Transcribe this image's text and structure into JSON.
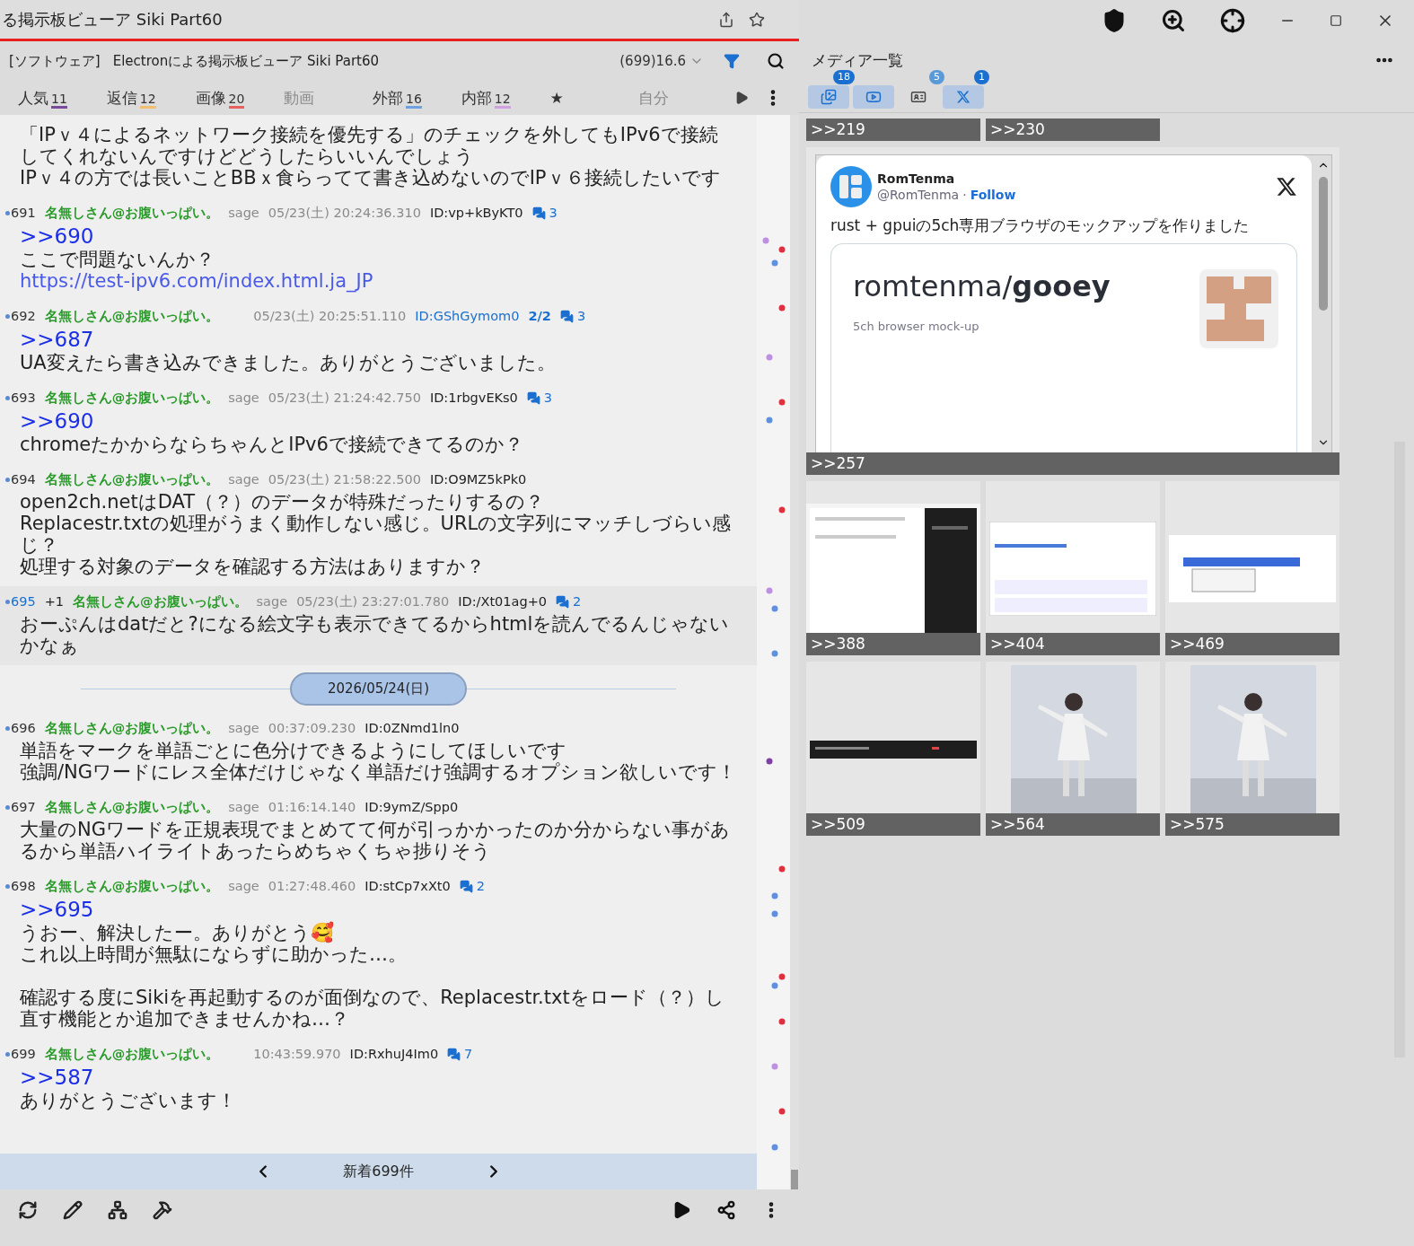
{
  "window": {
    "title": "る掲示板ビューア Siki Part60"
  },
  "thread": {
    "category": "[ソフトウェア]",
    "title": "Electronによる掲示板ビューア Siki Part60",
    "stats": "(699)16.6"
  },
  "tabs": [
    {
      "label": "人気",
      "count": "11",
      "color": "#7a4a9a",
      "disabled": false
    },
    {
      "label": "返信",
      "count": "12",
      "color": "#f0c070",
      "disabled": false
    },
    {
      "label": "画像",
      "count": "20",
      "color": "#e86060",
      "disabled": false
    },
    {
      "label": "動画",
      "disabled": true
    },
    {
      "label": "外部",
      "count": "16",
      "color": "#70a0e0",
      "disabled": false
    },
    {
      "label": "内部",
      "count": "12",
      "color": "#d0a0e0",
      "disabled": false
    },
    {
      "label": "★",
      "disabled": false
    },
    {
      "label": "自分",
      "disabled": true
    }
  ],
  "posts": [
    {
      "kind": "post",
      "body": [
        {
          "kind": "text",
          "text": "「IPｖ４によるネットワーク接続を優先する」のチェックを外してもIPv6で接続してくれないんですけどどうしたらいいんでしょう"
        },
        {
          "kind": "text",
          "text": "IPｖ４の方では長いことBBｘ食らってて書き込めないのでIPｖ６接続したいです"
        }
      ]
    },
    {
      "kind": "post",
      "number": "691",
      "name": "名無しさん@お腹いっぱい。",
      "mail": "sage",
      "time": "05/23(土) 20:24:36.310",
      "id": "ID:vp+kByKT0",
      "replies": "3",
      "highlighted": false,
      "body": [
        {
          "kind": "anchor",
          "text": ">>690"
        },
        {
          "kind": "text",
          "text": "ここで問題ないんか？"
        },
        {
          "kind": "link",
          "text": "https://test-ipv6.com/index.html.ja_JP"
        }
      ]
    },
    {
      "kind": "post",
      "number": "692",
      "name": "名無しさん@お腹いっぱい。",
      "time": "05/23(土) 20:25:51.110",
      "id": "ID:GShGymom0",
      "id_count": "2/2",
      "replies": "3",
      "highlighted": false,
      "body": [
        {
          "kind": "anchor",
          "text": ">>687"
        },
        {
          "kind": "text",
          "text": "UA変えたら書き込みできました。ありがとうございました。"
        }
      ]
    },
    {
      "kind": "post",
      "number": "693",
      "name": "名無しさん@お腹いっぱい。",
      "mail": "sage",
      "time": "05/23(土) 21:24:42.750",
      "id": "ID:1rbgvEKs0",
      "replies": "3",
      "highlighted": false,
      "body": [
        {
          "kind": "anchor",
          "text": ">>690"
        },
        {
          "kind": "text",
          "text": "chromeたかからならちゃんとIPv6で接続できてるのか？"
        }
      ]
    },
    {
      "kind": "post",
      "number": "694",
      "name": "名無しさん@お腹いっぱい。",
      "mail": "sage",
      "time": "05/23(土) 21:58:22.500",
      "id": "ID:O9MZ5kPk0",
      "highlighted": false,
      "body": [
        {
          "kind": "text",
          "text": "open2ch.netはDAT（？）のデータが特殊だったりするの？"
        },
        {
          "kind": "text",
          "text": "Replacestr.txtの処理がうまく動作しない感じ。URLの文字列にマッチしづらい感じ？"
        },
        {
          "kind": "text",
          "text": "処理する対象のデータを確認する方法はありますか？"
        }
      ]
    },
    {
      "kind": "post",
      "number": "695",
      "plus": "+1",
      "name": "名無しさん@お腹いっぱい。",
      "mail": "sage",
      "time": "05/23(土) 23:27:01.780",
      "id": "ID:/Xt01ag+0",
      "replies": "2",
      "highlighted": true,
      "body": [
        {
          "kind": "text",
          "text": "おーぷんはdatだと?になる絵文字も表示できてるからhtmlを読んでるんじゃないかなぁ"
        }
      ]
    },
    {
      "kind": "date",
      "text": "2026/05/24(日)"
    },
    {
      "kind": "post",
      "number": "696",
      "name": "名無しさん@お腹いっぱい。",
      "mail": "sage",
      "time": "00:37:09.230",
      "id": "ID:0ZNmd1ln0",
      "highlighted": false,
      "body": [
        {
          "kind": "text",
          "text": "単語をマークを単語ごとに色分けできるようにしてほしいです"
        },
        {
          "kind": "text",
          "text": "強調/NGワードにレス全体だけじゃなく単語だけ強調するオプション欲しいです！"
        }
      ]
    },
    {
      "kind": "post",
      "number": "697",
      "name": "名無しさん@お腹いっぱい。",
      "mail": "sage",
      "time": "01:16:14.140",
      "id": "ID:9ymZ/Spp0",
      "highlighted": false,
      "body": [
        {
          "kind": "text",
          "text": "大量のNGワードを正規表現でまとめてて何が引っかかったのか分からない事があるから単語ハイライトあったらめちゃくちゃ捗りそう"
        }
      ]
    },
    {
      "kind": "post",
      "number": "698",
      "name": "名無しさん@お腹いっぱい。",
      "mail": "sage",
      "time": "01:27:48.460",
      "id": "ID:stCp7xXt0",
      "replies": "2",
      "highlighted": false,
      "body": [
        {
          "kind": "anchor",
          "text": ">>695"
        },
        {
          "kind": "text",
          "text": "うおー、解決したー。ありがとう🥰"
        },
        {
          "kind": "text",
          "text": "これ以上時間が無駄にならずに助かった…。"
        },
        {
          "kind": "gap"
        },
        {
          "kind": "text",
          "text": "確認する度にSikiを再起動するのが面倒なので、Replacestr.txtをロード（？）し直す機能とか追加できませんかね…？"
        }
      ]
    },
    {
      "kind": "post",
      "number": "699",
      "name": "名無しさん@お腹いっぱい。",
      "time": "10:43:59.970",
      "id": "ID:RxhuJ4Im0",
      "replies": "7",
      "highlighted": false,
      "body": [
        {
          "kind": "anchor",
          "text": ">>587"
        },
        {
          "kind": "text",
          "text": "ありがとうございます！"
        }
      ]
    }
  ],
  "new_posts": "新着699件",
  "media": {
    "title": "メディア一覧",
    "filters": [
      {
        "badge": "18",
        "selected": true
      },
      {
        "kind": "video",
        "selected": true
      },
      {
        "kind": "card",
        "badge": "5",
        "selected": false
      },
      {
        "kind": "x",
        "badge": "1",
        "selected": true
      }
    ],
    "items": [
      {
        "kind": "label",
        "label": ">>219"
      },
      {
        "kind": "label",
        "label": ">>230"
      },
      {
        "kind": "tweet",
        "label": ">>257",
        "author": "RomTenma",
        "handle": "@RomTenma",
        "separator": "·",
        "follow": "Follow",
        "text": "rust + gpuiの5ch専用ブラウザのモックアップを作りました",
        "card_title": "romtenma/**gooey**",
        "card_subtitle": "5ch browser mock-up"
      },
      {
        "kind": "picture",
        "label": ">>388"
      },
      {
        "kind": "picture",
        "label": ">>404"
      },
      {
        "kind": "picture",
        "label": ">>469"
      },
      {
        "kind": "picture",
        "label": ">>509"
      },
      {
        "kind": "picture",
        "label": ">>564"
      },
      {
        "kind": "picture",
        "label": ">>575"
      }
    ]
  }
}
